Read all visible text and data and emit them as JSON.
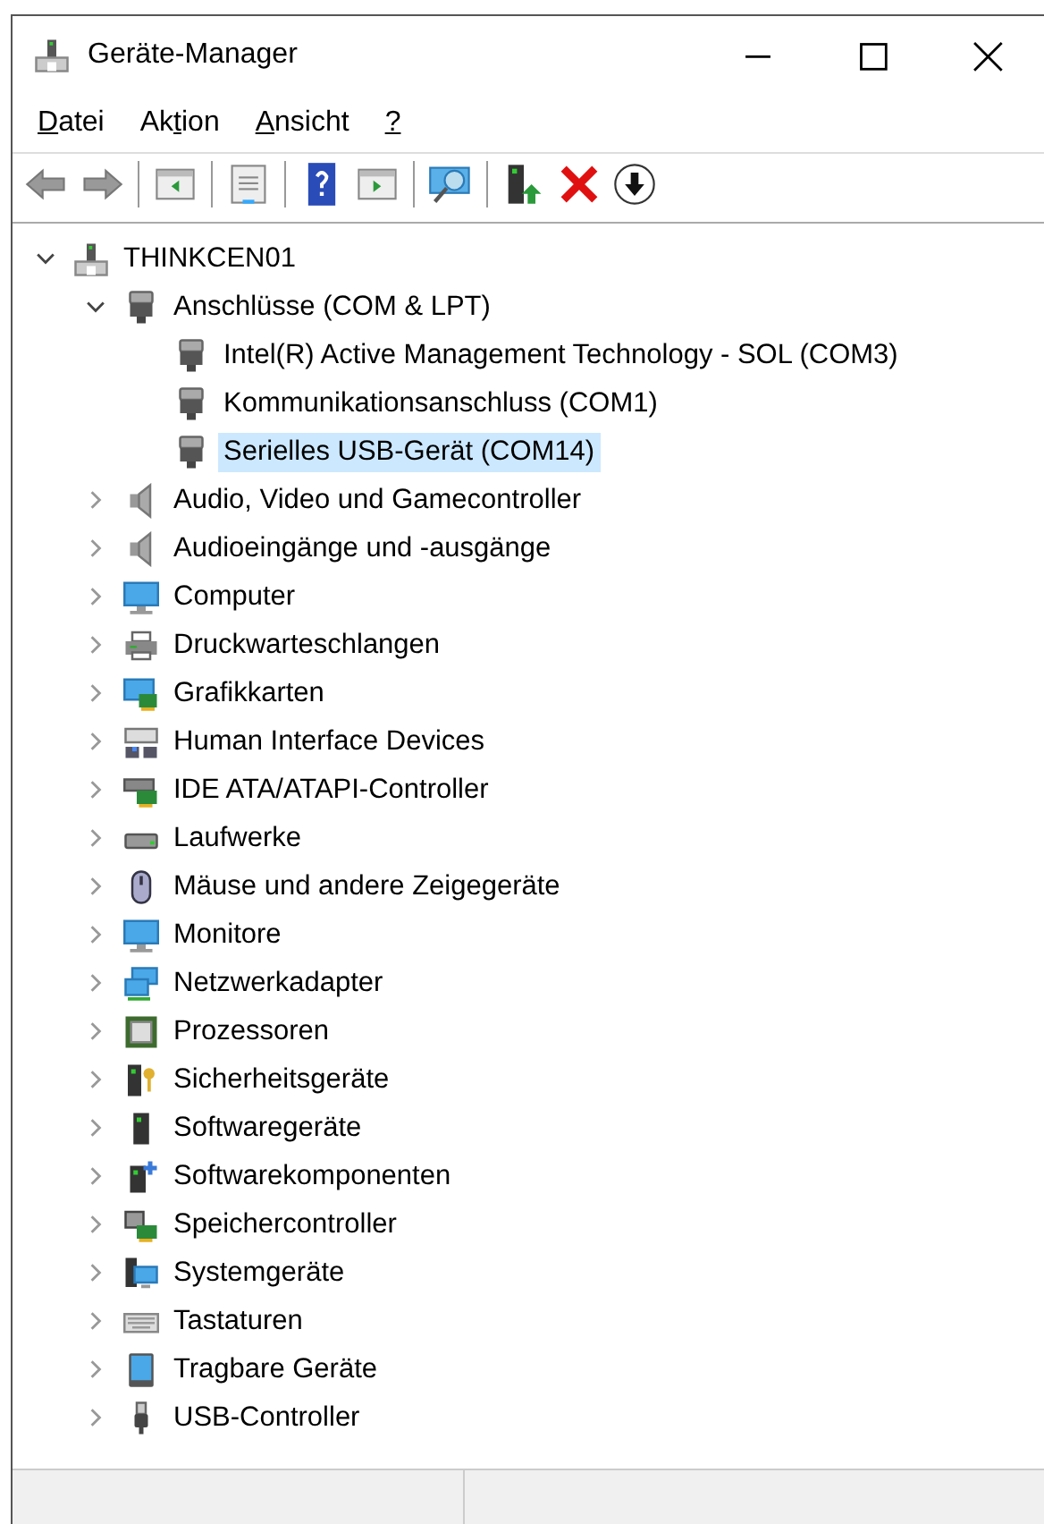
{
  "window": {
    "title": "Geräte-Manager"
  },
  "menu": [
    {
      "key": "D",
      "after": "atei"
    },
    {
      "before": "Ak",
      "key": "t",
      "after": "ion"
    },
    {
      "key": "A",
      "after": "nsicht"
    },
    {
      "key": "?"
    }
  ],
  "toolbar": [
    {
      "kind": "back"
    },
    {
      "kind": "forward"
    },
    {
      "kind": "sep"
    },
    {
      "kind": "panel-left"
    },
    {
      "kind": "sep"
    },
    {
      "kind": "properties"
    },
    {
      "kind": "sep"
    },
    {
      "kind": "help"
    },
    {
      "kind": "panel-right"
    },
    {
      "kind": "sep"
    },
    {
      "kind": "scan"
    },
    {
      "kind": "sep"
    },
    {
      "kind": "update"
    },
    {
      "kind": "uninstall"
    },
    {
      "kind": "download"
    }
  ],
  "tree": [
    {
      "label": "THINKCEN01",
      "kind": "computer",
      "expanded": true,
      "selected": false,
      "children": [
        {
          "label": "Anschlüsse (COM & LPT)",
          "kind": "port",
          "expanded": true,
          "selected": false,
          "children": [
            {
              "label": "Intel(R) Active Management Technology - SOL (COM3)",
              "kind": "port",
              "selected": false
            },
            {
              "label": "Kommunikationsanschluss (COM1)",
              "kind": "port",
              "selected": false
            },
            {
              "label": "Serielles USB-Gerät (COM14)",
              "kind": "port",
              "selected": true
            }
          ]
        },
        {
          "label": "Audio, Video und Gamecontroller",
          "kind": "speaker",
          "expanded": false,
          "selected": false
        },
        {
          "label": "Audioeingänge und -ausgänge",
          "kind": "speaker",
          "expanded": false,
          "selected": false
        },
        {
          "label": "Computer",
          "kind": "monitor",
          "expanded": false,
          "selected": false
        },
        {
          "label": "Druckwarteschlangen",
          "kind": "printer",
          "expanded": false,
          "selected": false
        },
        {
          "label": "Grafikkarten",
          "kind": "graphics",
          "expanded": false,
          "selected": false
        },
        {
          "label": "Human Interface Devices",
          "kind": "hid",
          "expanded": false,
          "selected": false
        },
        {
          "label": "IDE ATA/ATAPI-Controller",
          "kind": "ide",
          "expanded": false,
          "selected": false
        },
        {
          "label": "Laufwerke",
          "kind": "drive",
          "expanded": false,
          "selected": false
        },
        {
          "label": "Mäuse und andere Zeigegeräte",
          "kind": "mouse",
          "expanded": false,
          "selected": false
        },
        {
          "label": "Monitore",
          "kind": "monitor",
          "expanded": false,
          "selected": false
        },
        {
          "label": "Netzwerkadapter",
          "kind": "network",
          "expanded": false,
          "selected": false
        },
        {
          "label": "Prozessoren",
          "kind": "cpu",
          "expanded": false,
          "selected": false
        },
        {
          "label": "Sicherheitsgeräte",
          "kind": "security",
          "expanded": false,
          "selected": false
        },
        {
          "label": "Softwaregeräte",
          "kind": "tower",
          "expanded": false,
          "selected": false
        },
        {
          "label": "Softwarekomponenten",
          "kind": "component",
          "expanded": false,
          "selected": false
        },
        {
          "label": "Speichercontroller",
          "kind": "storage",
          "expanded": false,
          "selected": false
        },
        {
          "label": "Systemgeräte",
          "kind": "system",
          "expanded": false,
          "selected": false
        },
        {
          "label": "Tastaturen",
          "kind": "keyboard",
          "expanded": false,
          "selected": false
        },
        {
          "label": "Tragbare Geräte",
          "kind": "tablet",
          "expanded": false,
          "selected": false
        },
        {
          "label": "USB-Controller",
          "kind": "usb",
          "expanded": false,
          "selected": false
        }
      ]
    }
  ]
}
